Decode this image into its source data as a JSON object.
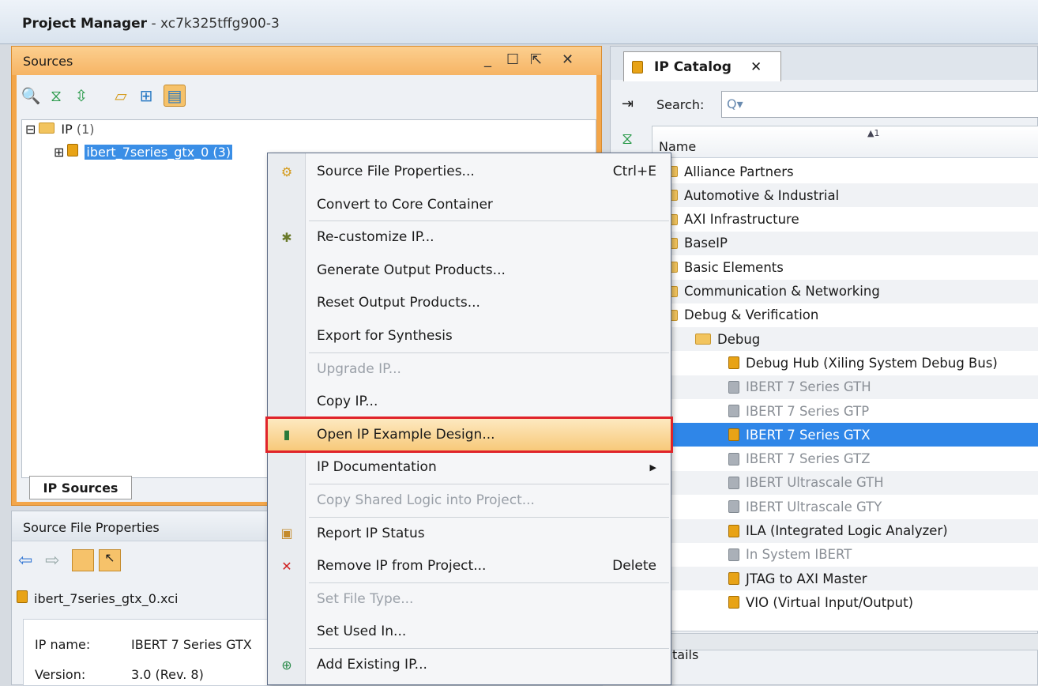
{
  "window": {
    "title": "Project Manager",
    "subtitle": " - xc7k325tffg900-3"
  },
  "sources": {
    "title": "Sources",
    "controls": [
      "_",
      "☐",
      "⇱",
      "✕"
    ],
    "tree": {
      "root": "IP",
      "root_count": "(1)",
      "child": "ibert_7series_gtx_0 (3)"
    },
    "tab": "IP Sources"
  },
  "sfp": {
    "title": "Source File Properties",
    "file": "ibert_7series_gtx_0.xci",
    "ip_name_label": "IP name:",
    "ip_name_value": "IBERT 7 Series GTX",
    "version_label": "Version:",
    "version_value": "3.0 (Rev. 8)"
  },
  "ipcatalog": {
    "tab": "IP Catalog",
    "tab_close": "✕",
    "search_label": "Search:",
    "search_placeholder": "Q▾",
    "col_name": "Name",
    "sort_marker": "▲1",
    "details_label": "tails",
    "rows": [
      {
        "label": "Alliance Partners",
        "kind": "folder",
        "indent": 0,
        "dim": false
      },
      {
        "label": "Automotive & Industrial",
        "kind": "folder",
        "indent": 0,
        "dim": false
      },
      {
        "label": "AXI Infrastructure",
        "kind": "folder",
        "indent": 0,
        "dim": false
      },
      {
        "label": "BaseIP",
        "kind": "folder",
        "indent": 0,
        "dim": false
      },
      {
        "label": "Basic Elements",
        "kind": "folder",
        "indent": 0,
        "dim": false
      },
      {
        "label": "Communication & Networking",
        "kind": "folder",
        "indent": 0,
        "dim": false
      },
      {
        "label": "Debug & Verification",
        "kind": "folder",
        "indent": 0,
        "dim": false
      },
      {
        "label": "Debug",
        "kind": "folder",
        "indent": 1,
        "dim": false
      },
      {
        "label": "Debug Hub (Xiling System Debug Bus)",
        "kind": "ip",
        "indent": 2,
        "dim": false
      },
      {
        "label": "IBERT 7 Series GTH",
        "kind": "ip",
        "indent": 2,
        "dim": true
      },
      {
        "label": "IBERT 7 Series GTP",
        "kind": "ip",
        "indent": 2,
        "dim": true
      },
      {
        "label": "IBERT 7 Series GTX",
        "kind": "ip",
        "indent": 2,
        "dim": false,
        "selected": true
      },
      {
        "label": "IBERT 7 Series GTZ",
        "kind": "ip",
        "indent": 2,
        "dim": true
      },
      {
        "label": "IBERT Ultrascale GTH",
        "kind": "ip",
        "indent": 2,
        "dim": true
      },
      {
        "label": "IBERT Ultrascale GTY",
        "kind": "ip",
        "indent": 2,
        "dim": true
      },
      {
        "label": "ILA (Integrated Logic Analyzer)",
        "kind": "ip",
        "indent": 2,
        "dim": false
      },
      {
        "label": "In System IBERT",
        "kind": "ip",
        "indent": 2,
        "dim": true
      },
      {
        "label": "JTAG to AXI Master",
        "kind": "ip",
        "indent": 2,
        "dim": false
      },
      {
        "label": "VIO (Virtual Input/Output)",
        "kind": "ip",
        "indent": 2,
        "dim": false
      }
    ]
  },
  "menu": {
    "items": [
      {
        "label": "Source File Properties...",
        "shortcut": "Ctrl+E",
        "icon": "properties-icon",
        "disabled": false
      },
      {
        "label": "Convert to Core Container",
        "shortcut": "",
        "icon": "",
        "disabled": false
      },
      {
        "label": "Re-customize IP...",
        "shortcut": "",
        "icon": "recustomize-icon",
        "disabled": false
      },
      {
        "label": "Generate Output Products...",
        "shortcut": "",
        "icon": "",
        "disabled": false
      },
      {
        "label": "Reset Output Products...",
        "shortcut": "",
        "icon": "",
        "disabled": false
      },
      {
        "label": "Export for Synthesis",
        "shortcut": "",
        "icon": "",
        "disabled": false
      },
      {
        "label": "Upgrade IP...",
        "shortcut": "",
        "icon": "",
        "disabled": true
      },
      {
        "label": "Copy IP...",
        "shortcut": "",
        "icon": "",
        "disabled": false
      },
      {
        "label": "Open IP Example Design...",
        "shortcut": "",
        "icon": "example-design-icon",
        "disabled": false,
        "highlighted": true
      },
      {
        "label": "IP Documentation",
        "shortcut": "▶",
        "icon": "",
        "disabled": false
      },
      {
        "label": "Copy Shared Logic into Project...",
        "shortcut": "",
        "icon": "",
        "disabled": true
      },
      {
        "label": "Report IP Status",
        "shortcut": "",
        "icon": "report-icon",
        "disabled": false
      },
      {
        "label": "Remove IP from Project...",
        "shortcut": "Delete",
        "icon": "remove-icon",
        "disabled": false
      },
      {
        "label": "Set File Type...",
        "shortcut": "",
        "icon": "",
        "disabled": true
      },
      {
        "label": "Set Used In...",
        "shortcut": "",
        "icon": "",
        "disabled": false
      },
      {
        "label": "Add Existing IP...",
        "shortcut": "",
        "icon": "add-ip-icon",
        "disabled": false
      }
    ]
  },
  "colors": {
    "accent": "#f3a64a",
    "selection": "#2f86e8",
    "highlight_border": "#e0242a"
  }
}
